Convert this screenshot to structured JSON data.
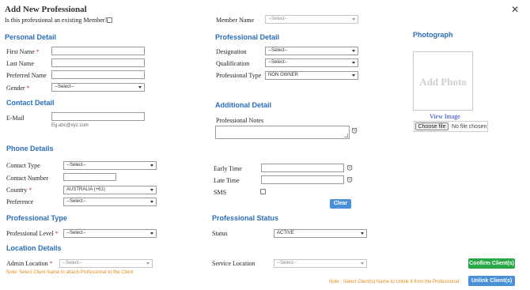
{
  "header": {
    "title": "Add New Professional",
    "close_icon": "close-icon"
  },
  "existing_member": {
    "label": "Is this professional an existing Member?"
  },
  "member_name": {
    "label": "Member Name",
    "value": "--Select--"
  },
  "personal": {
    "heading": "Personal Detail",
    "first_name_label": "First Name",
    "last_name_label": "Last Name",
    "preferred_name_label": "Preferred Name",
    "gender_label": "Gender",
    "gender_value": "--Select--",
    "required_mark": "*"
  },
  "contact": {
    "heading": "Contact Detail",
    "email_label": "E-Mail",
    "email_hint": "Eg.abc@xyz.com"
  },
  "professional": {
    "heading": "Professional Detail",
    "designation_label": "Designation",
    "designation_value": "--Select--",
    "qualification_label": "Qualification",
    "qualification_value": "--Select--",
    "type_label": "Professional Type",
    "type_value": "NON OWNER"
  },
  "photo": {
    "heading": "Photograph",
    "placeholder": "Add Photo",
    "view_link": "View Image",
    "choose_button": "Choose file",
    "no_file": "No file chosen"
  },
  "additional": {
    "heading": "Additional Detail",
    "notes_label": "Professional Notes"
  },
  "phone": {
    "heading": "Phone Details",
    "contact_type_label": "Contact Type",
    "contact_type_value": "--Select--",
    "contact_number_label": "Contact Number",
    "country_label": "Country",
    "country_value": "AUSTRALIA (+61)",
    "preference_label": "Preference",
    "preference_value": "--Select--"
  },
  "timing": {
    "early_label": "Early Time",
    "late_label": "Late Time",
    "sms_label": "SMS",
    "clear_button": "Clear"
  },
  "prof_type": {
    "heading": "Professional Type",
    "level_label": "Professional Level",
    "level_value": "--Select--"
  },
  "prof_status": {
    "heading": "Professional Status",
    "status_label": "Status",
    "status_value": "ACTIVE"
  },
  "location": {
    "heading": "Location Details",
    "admin_label": "Admin Location",
    "admin_value": "--Select--",
    "admin_note": "Note: Select Client Name to attach Professional to the Client",
    "service_label": "Service Location",
    "service_value": "--Select--",
    "unlink_note": "Note : Select Client(s) Name to Unlink it from the Professional",
    "confirm_button": "Confirm Client(s)",
    "unlink_button": "Unlink Client(s)"
  },
  "colors": {
    "accent": "#2a6ebb",
    "required": "#dd3333",
    "note": "#e08a1e",
    "confirm": "#27a844",
    "button": "#4a90d9"
  }
}
